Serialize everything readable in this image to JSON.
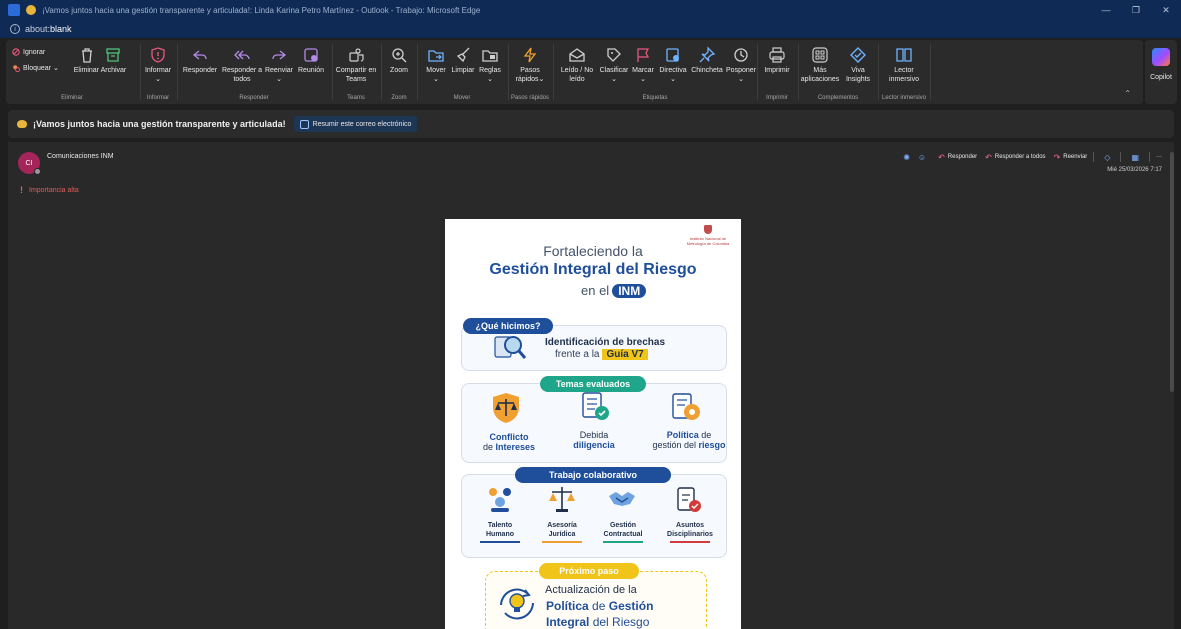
{
  "window": {
    "title": "¡Vamos juntos hacia una gestión transparente y articulada!: Linda Karina Petro Martínez - Outlook - Trabajo: Microsoft Edge",
    "address": "about:",
    "address_strong": "blank"
  },
  "ribbon": {
    "groups": {
      "eliminar": {
        "label": "Eliminar",
        "ignorar": "Ignorar",
        "bloquear": "Bloquear",
        "eliminar_archivar": "Eliminar Archivar"
      },
      "informar": {
        "label": "Informar",
        "btn": "Informar"
      },
      "responder": {
        "label": "Responder",
        "responder": "Responder",
        "responder_todos_1": "Responder a",
        "responder_todos_2": "todos",
        "reenviar": "Reenviar",
        "reunion": "Reunión"
      },
      "teams": {
        "label": "Teams",
        "btn1": "Compartir en",
        "btn2": "Teams"
      },
      "zoom": {
        "label": "Zoom",
        "btn": "Zoom"
      },
      "mover": {
        "label": "Mover",
        "mover": "Mover",
        "limpiar": "Limpiar",
        "reglas": "Reglas"
      },
      "pasos": {
        "label": "Pasos rápidos",
        "btn1": "Pasos",
        "btn2": "rápidos"
      },
      "etiquetas": {
        "label": "Etiquetas",
        "leido1": "Leído / No",
        "leido2": "leído",
        "clasificar": "Clasificar",
        "marcar": "Marcar",
        "directiva": "Directiva",
        "chincheta": "Chincheta",
        "posponer": "Posponer"
      },
      "imprimir": {
        "label": "Imprimir",
        "btn": "Imprimir"
      },
      "complementos": {
        "label": "Complementos",
        "mas1": "Más",
        "mas2": "aplicaciones",
        "viva1": "Viva",
        "viva2": "Insights"
      },
      "lector": {
        "label": "Lector inmersivo",
        "btn1": "Lector",
        "btn2": "inmersivo"
      }
    },
    "copilot": "Copilot"
  },
  "subject": {
    "text": "¡Vamos juntos hacia una gestión transparente y articulada!",
    "summarize": "Resumir este correo electrónico"
  },
  "message": {
    "avatar_initials": "CI",
    "sender": "Comunicaciones INM",
    "importance": "Importancia alta",
    "actions": {
      "responder": "Responder",
      "responder_todos": "Responder a todos",
      "reenviar": "Reenviar"
    },
    "date": "Mié 25/03/2026 7:17"
  },
  "poster": {
    "logo_line1": "Instituto Nacional de",
    "logo_line2": "Metrología de Colombia",
    "title1": "Fortaleciendo la",
    "title2": "Gestión Integral del Riesgo",
    "title3": "en el",
    "title3_pill": "INM",
    "que_hicimos": "¿Qué hicimos?",
    "brechas1": "Identificación de brechas",
    "brechas2": "frente a la",
    "guia": "Guía V7",
    "temas": "Temas evaluados",
    "tema1_a": "Conflicto",
    "tema1_b": "de",
    "tema1_c": "Intereses",
    "tema2_a": "Debida",
    "tema2_b": "diligencia",
    "tema3_a": "Política",
    "tema3_b": "de",
    "tema3_c": "gestión del",
    "tema3_d": "riesgo",
    "trabajo": "Trabajo colaborativo",
    "c1a": "Talento",
    "c1b": "Humano",
    "c2a": "Asesoría",
    "c2b": "Jurídica",
    "c3a": "Gestión",
    "c3b": "Contractual",
    "c4a": "Asuntos",
    "c4b": "Disciplinarios",
    "proximo": "Próximo paso",
    "next1": "Actualización de la",
    "next2_a": "Política",
    "next2_b": "de",
    "next2_c": "Gestión",
    "next3_a": "Integral",
    "next3_b": "del Riesgo"
  }
}
